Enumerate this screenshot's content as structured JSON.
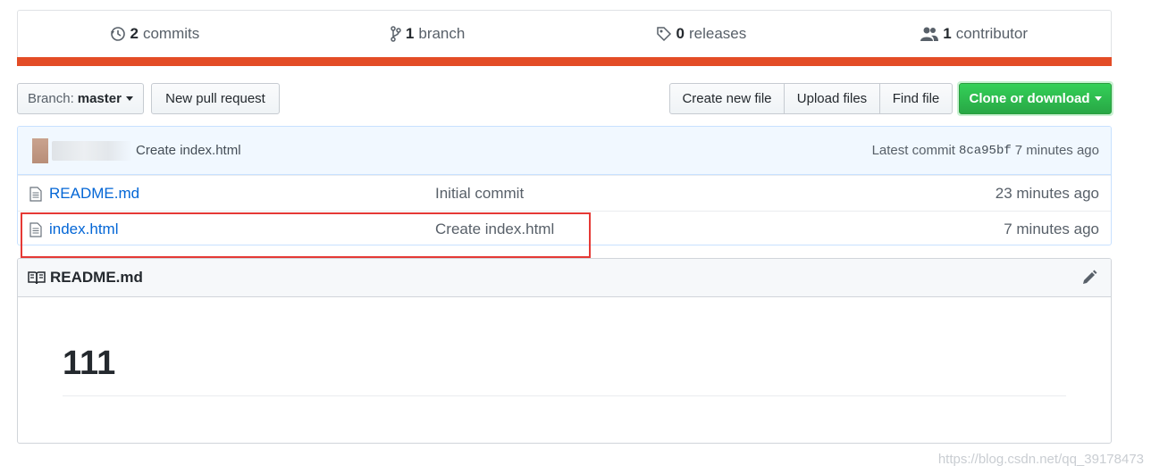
{
  "summary": {
    "commits": {
      "num": "2",
      "label": "commits",
      "icon": "history-icon"
    },
    "branches": {
      "num": "1",
      "label": "branch",
      "icon": "branch-icon"
    },
    "releases": {
      "num": "0",
      "label": "releases",
      "icon": "tag-icon"
    },
    "contributors": {
      "num": "1",
      "label": "contributor",
      "icon": "people-icon"
    },
    "lang_color": "#e34c26"
  },
  "toolbar": {
    "branch_prefix": "Branch:",
    "branch_name": "master",
    "new_pr": "New pull request",
    "create_file": "Create new file",
    "upload_files": "Upload files",
    "find_file": "Find file",
    "clone": "Clone or download",
    "clone_color": "#28a745"
  },
  "commit_tease": {
    "message": "Create index.html",
    "latest_label": "Latest commit",
    "sha": "8ca95bf",
    "age": "7 minutes ago"
  },
  "files": [
    {
      "name": "README.md",
      "message": "Initial commit",
      "age": "23 minutes ago"
    },
    {
      "name": "index.html",
      "message": "Create index.html",
      "age": "7 minutes ago"
    }
  ],
  "readme": {
    "title": "README.md",
    "heading": "111"
  },
  "watermark": "https://blog.csdn.net/qq_39178473",
  "highlight_color": "#e53935"
}
